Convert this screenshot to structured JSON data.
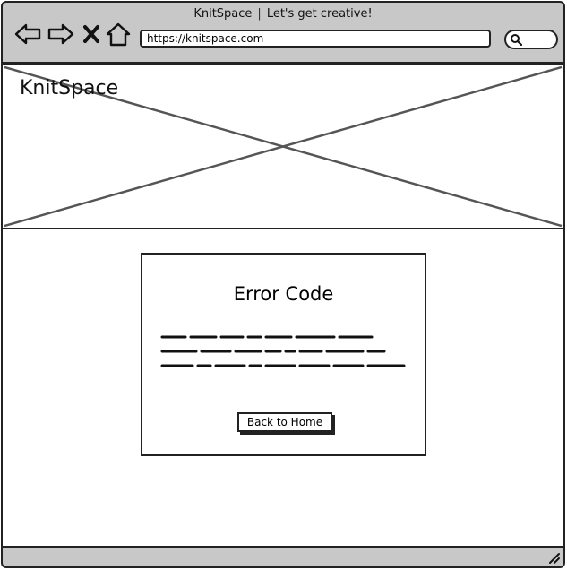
{
  "window": {
    "site_name": "KnitSpace",
    "separator": "|",
    "tagline": "Let's get creative!"
  },
  "toolbar": {
    "icons": [
      "back-arrow-icon",
      "forward-arrow-icon",
      "close-x-icon",
      "home-icon"
    ],
    "url": "https://knitspace.com",
    "search_icon": "search-icon"
  },
  "header": {
    "brand": "KnitSpace"
  },
  "error_card": {
    "title": "Error Code",
    "button_label": "Back to Home"
  }
}
